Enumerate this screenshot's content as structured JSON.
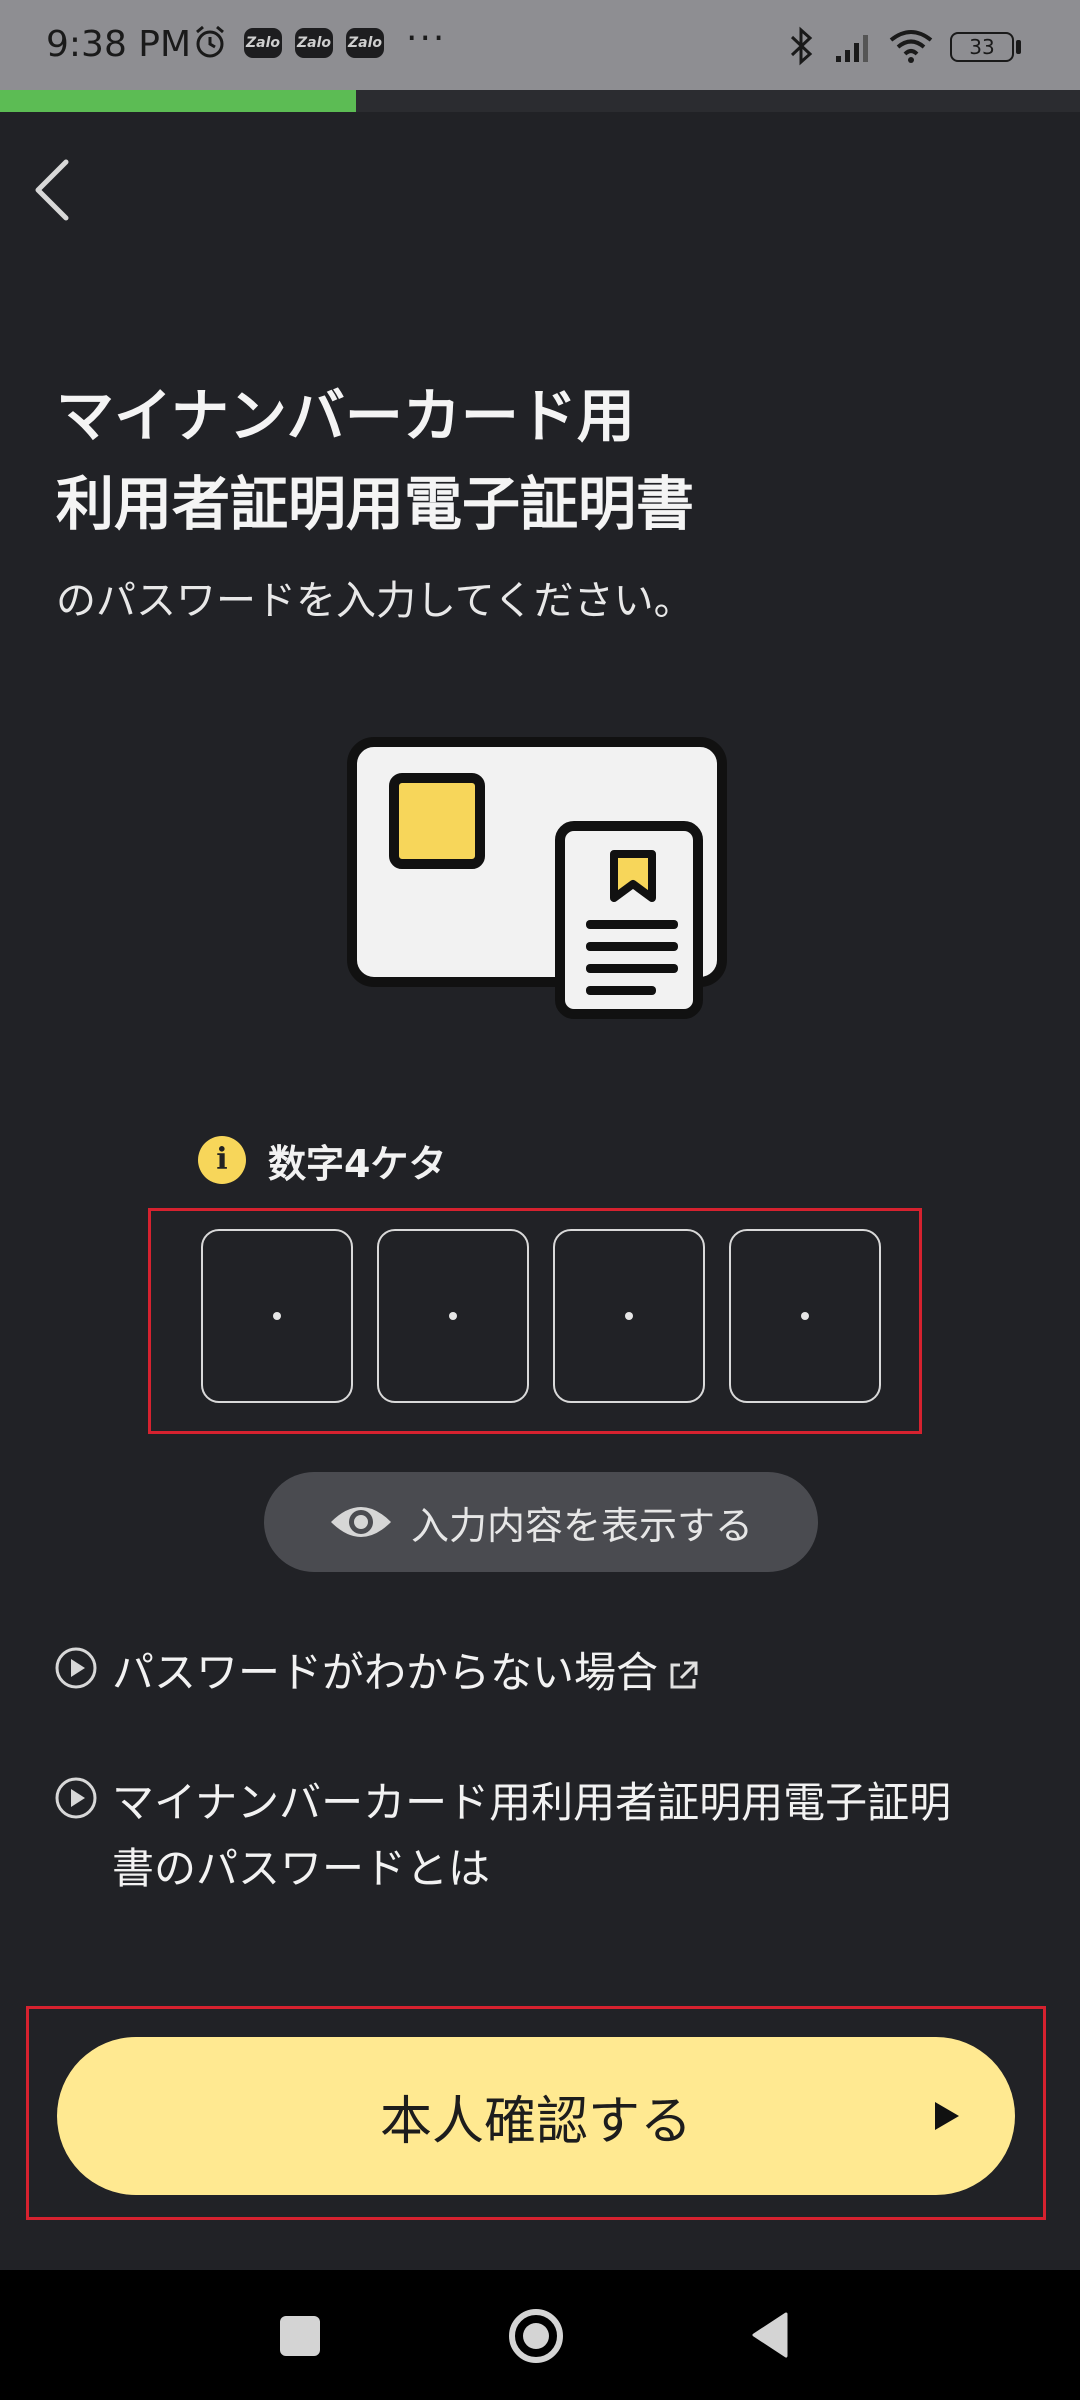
{
  "status_bar": {
    "time": "9:38 PM",
    "notification_apps": [
      "Zalo",
      "Zalo",
      "Zalo"
    ],
    "more": "···",
    "battery": "33",
    "icons": [
      "alarm-icon",
      "bluetooth-icon",
      "signal-icon",
      "wifi-icon",
      "battery-icon"
    ]
  },
  "progress": {
    "fraction": 0.33,
    "color": "#5cbc54"
  },
  "header": {
    "back_icon": "chevron-left-icon"
  },
  "title": {
    "line1": "マイナンバーカード用",
    "line2": "利用者証明用電子証明書",
    "subtitle": "のパスワードを入力してください。"
  },
  "illustration": {
    "icon": "id-card-with-certificate-icon"
  },
  "pin": {
    "hint": "数字4ケタ",
    "info_icon": "i",
    "digits": [
      "・",
      "・",
      "・",
      "・"
    ]
  },
  "toggle": {
    "label": "入力内容を表示する",
    "icon": "eye-icon"
  },
  "links": [
    {
      "text": "パスワードがわからない場合",
      "external": true
    },
    {
      "text_line1": "マイナンバーカード用利用者証明用電子証明",
      "text_line2": "書のパスワードとは"
    }
  ],
  "submit": {
    "label": "本人確認する",
    "color": "#ffe991"
  },
  "nav": {
    "icons": [
      "recents-square-icon",
      "home-circle-icon",
      "back-triangle-icon"
    ]
  }
}
